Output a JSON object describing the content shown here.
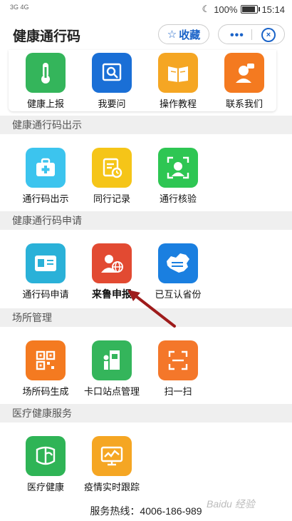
{
  "status_bar": {
    "signal_left": "3G 4G",
    "battery_percent": "100%",
    "time": "15:14"
  },
  "header": {
    "title": "健康通行码",
    "favorite_label": "收藏"
  },
  "top_items": [
    {
      "label": "健康上报",
      "color": "#34b55b",
      "icon": "thermometer-icon"
    },
    {
      "label": "我要问",
      "color": "#1a6fd6",
      "icon": "search-question-icon"
    },
    {
      "label": "操作教程",
      "color": "#f5a623",
      "icon": "book-icon"
    },
    {
      "label": "联系我们",
      "color": "#f47a20",
      "icon": "support-agent-icon"
    }
  ],
  "sections": [
    {
      "title": "健康通行码出示",
      "items": [
        {
          "label": "通行码出示",
          "color": "#3cc4ee",
          "icon": "medical-kit-icon"
        },
        {
          "label": "同行记录",
          "color": "#f5c518",
          "icon": "record-clock-icon"
        },
        {
          "label": "通行核验",
          "color": "#2ec653",
          "icon": "face-scan-icon"
        }
      ]
    },
    {
      "title": "健康通行码申请",
      "items": [
        {
          "label": "通行码申请",
          "color": "#2ab1d8",
          "icon": "id-card-icon"
        },
        {
          "label": "来鲁申报",
          "color": "#e24a32",
          "icon": "person-globe-icon"
        },
        {
          "label": "已互认省份",
          "color": "#1a7fe0",
          "icon": "china-map-icon"
        }
      ]
    },
    {
      "title": "场所管理",
      "items": [
        {
          "label": "场所码生成",
          "color": "#f47a20",
          "icon": "qr-code-icon"
        },
        {
          "label": "卡口站点管理",
          "color": "#34b55b",
          "icon": "checkpoint-icon"
        },
        {
          "label": "扫一扫",
          "color": "#f4772a",
          "icon": "scan-icon"
        }
      ]
    },
    {
      "title": "医疗健康服务",
      "items": [
        {
          "label": "医疗健康",
          "color": "#2fb456",
          "icon": "health-shield-icon"
        },
        {
          "label": "疫情实时跟踪",
          "color": "#f5a623",
          "icon": "monitor-chart-icon"
        }
      ]
    }
  ],
  "footer": {
    "hotline": "服务热线：4006-186-989"
  },
  "watermark": "Baidu 经验"
}
